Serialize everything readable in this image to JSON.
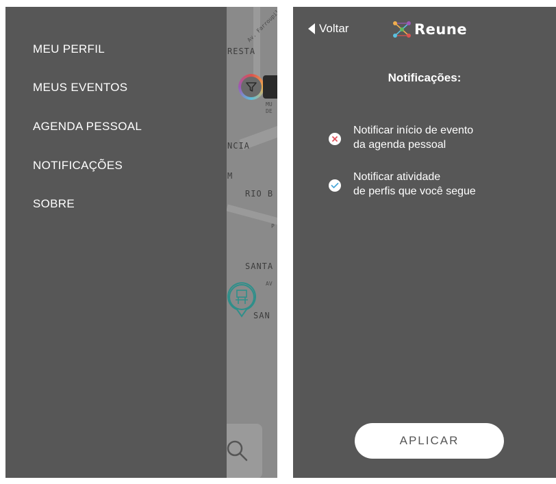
{
  "drawer": {
    "items": [
      {
        "label": "MEU PERFIL"
      },
      {
        "label": "MEUS EVENTOS"
      },
      {
        "label": "AGENDA PESSOAL"
      },
      {
        "label": "NOTIFICAÇÕES"
      },
      {
        "label": "SOBRE"
      }
    ]
  },
  "map": {
    "labels": [
      "RESTA",
      "NCIA",
      "M",
      "RIO B",
      "SANTA",
      "SAN"
    ],
    "small_labels": [
      "Av. Farroupilha",
      "MU DE",
      "P",
      "AV"
    ]
  },
  "header": {
    "back_label": "Voltar",
    "logo_text": "Reune"
  },
  "notifications": {
    "title": "Notificações:",
    "options": [
      {
        "line1": "Notificar início de evento",
        "line2": "da agenda pessoal",
        "enabled": false,
        "icon": "x-circle-icon"
      },
      {
        "line1": "Notificar atividade",
        "line2": "de perfis que você segue",
        "enabled": true,
        "icon": "check-circle-icon"
      }
    ],
    "apply_label": "APLICAR"
  },
  "colors": {
    "drawer_bg": "#575757",
    "disabled_icon": "#e0505a",
    "enabled_icon": "#4aa8d8"
  }
}
